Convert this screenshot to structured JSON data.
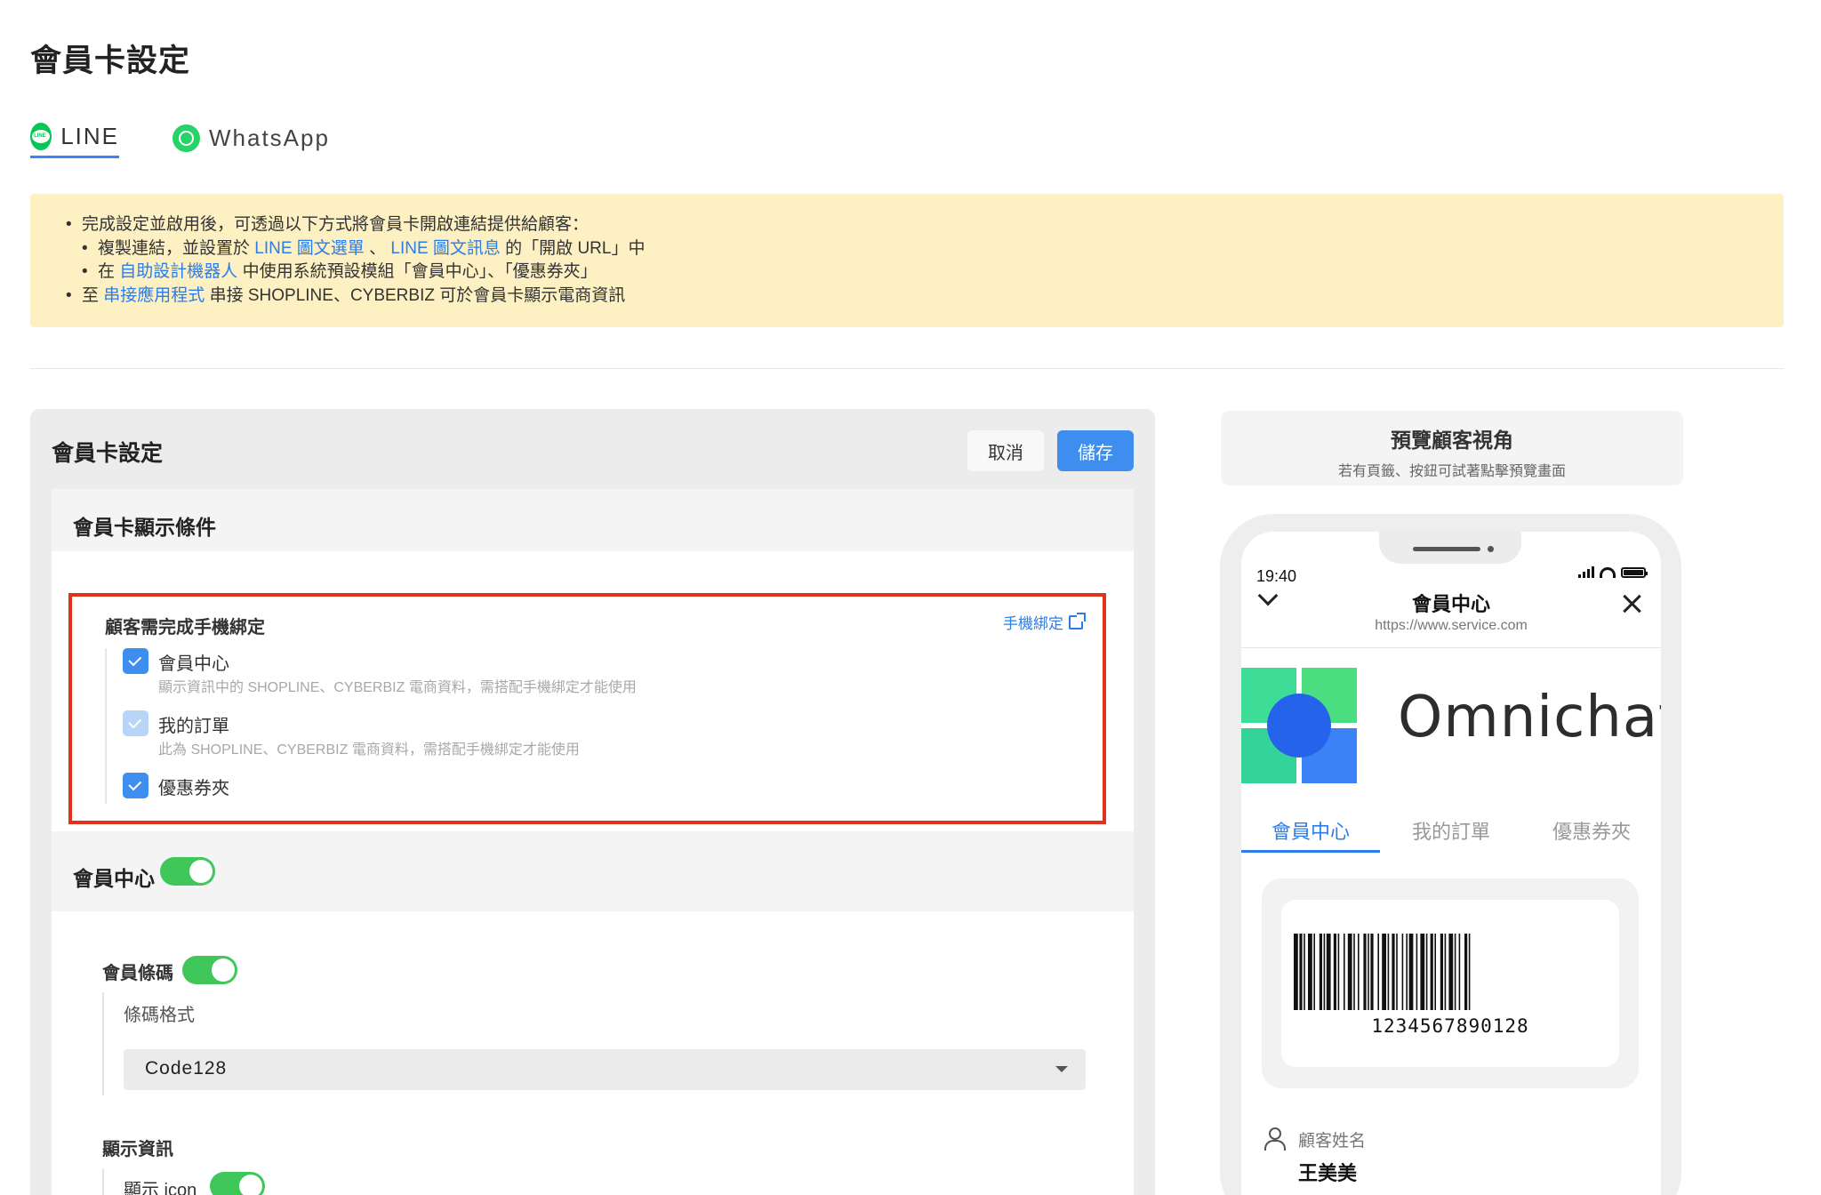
{
  "page": {
    "title": "會員卡設定"
  },
  "tabs": [
    {
      "label": "LINE",
      "active": true,
      "icon": "line-icon"
    },
    {
      "label": "WhatsApp",
      "active": false,
      "icon": "whatsapp-icon"
    }
  ],
  "notice": {
    "line1": "完成設定並啟用後，可透過以下方式將會員卡開啟連結提供給顧客：",
    "line2_prefix": "複製連結，並設置於 ",
    "line2_link1": "LINE 圖文選單",
    "line2_sep": " 、 ",
    "line2_link2": "LINE 圖文訊息",
    "line2_suffix": " 的「開啟 URL」中",
    "line3_prefix": "在 ",
    "line3_link": "自助設計機器人",
    "line3_suffix": " 中使用系統預設模組「會員中心」、「優惠券夾」",
    "line4_prefix": "至 ",
    "line4_link": "串接應用程式",
    "line4_suffix": " 串接 SHOPLINE、CYBERBIZ 可於會員卡顯示電商資訊"
  },
  "settings": {
    "title": "會員卡設定",
    "cancel_label": "取消",
    "save_label": "儲存",
    "display_conditions": {
      "title": "會員卡顯示條件",
      "phone_binding": {
        "title": "顧客需完成手機綁定",
        "link_label": "手機綁定",
        "items": [
          {
            "label": "會員中心",
            "desc": "顯示資訊中的 SHOPLINE、CYBERBIZ 電商資料，需搭配手機綁定才能使用",
            "checked": true,
            "disabled": false
          },
          {
            "label": "我的訂單",
            "desc": "此為 SHOPLINE、CYBERBIZ 電商資料，需搭配手機綁定才能使用",
            "checked": true,
            "disabled": true
          },
          {
            "label": "優惠券夾",
            "desc": "",
            "checked": true,
            "disabled": false
          }
        ]
      }
    },
    "member_center": {
      "label": "會員中心",
      "enabled": true,
      "barcode": {
        "label": "會員條碼",
        "enabled": true,
        "format_label": "條碼格式",
        "format_value": "Code128"
      },
      "display_info": {
        "label": "顯示資訊",
        "show_icon_label": "顯示 icon",
        "show_icon_enabled": true
      }
    }
  },
  "preview": {
    "title": "預覽顧客視角",
    "subtitle": "若有頁籤、按鈕可試著點擊預覽畫面",
    "phone": {
      "time": "19:40",
      "header_title": "會員中心",
      "url": "https://www.service.com",
      "brand": "Omnichat",
      "tabs": [
        "會員中心",
        "我的訂單",
        "優惠券夾"
      ],
      "active_tab": 0,
      "barcode_number": "1234567890128",
      "field_label": "顧客姓名",
      "field_value": "王美美"
    }
  },
  "colors": {
    "accent": "#3e8ef0",
    "link": "#2b7de9",
    "toggle_on": "#3fc75a",
    "notice_bg": "#fdf0c2",
    "highlight_border": "#e0321f",
    "line_green": "#06c755",
    "whatsapp_green": "#25d366"
  }
}
